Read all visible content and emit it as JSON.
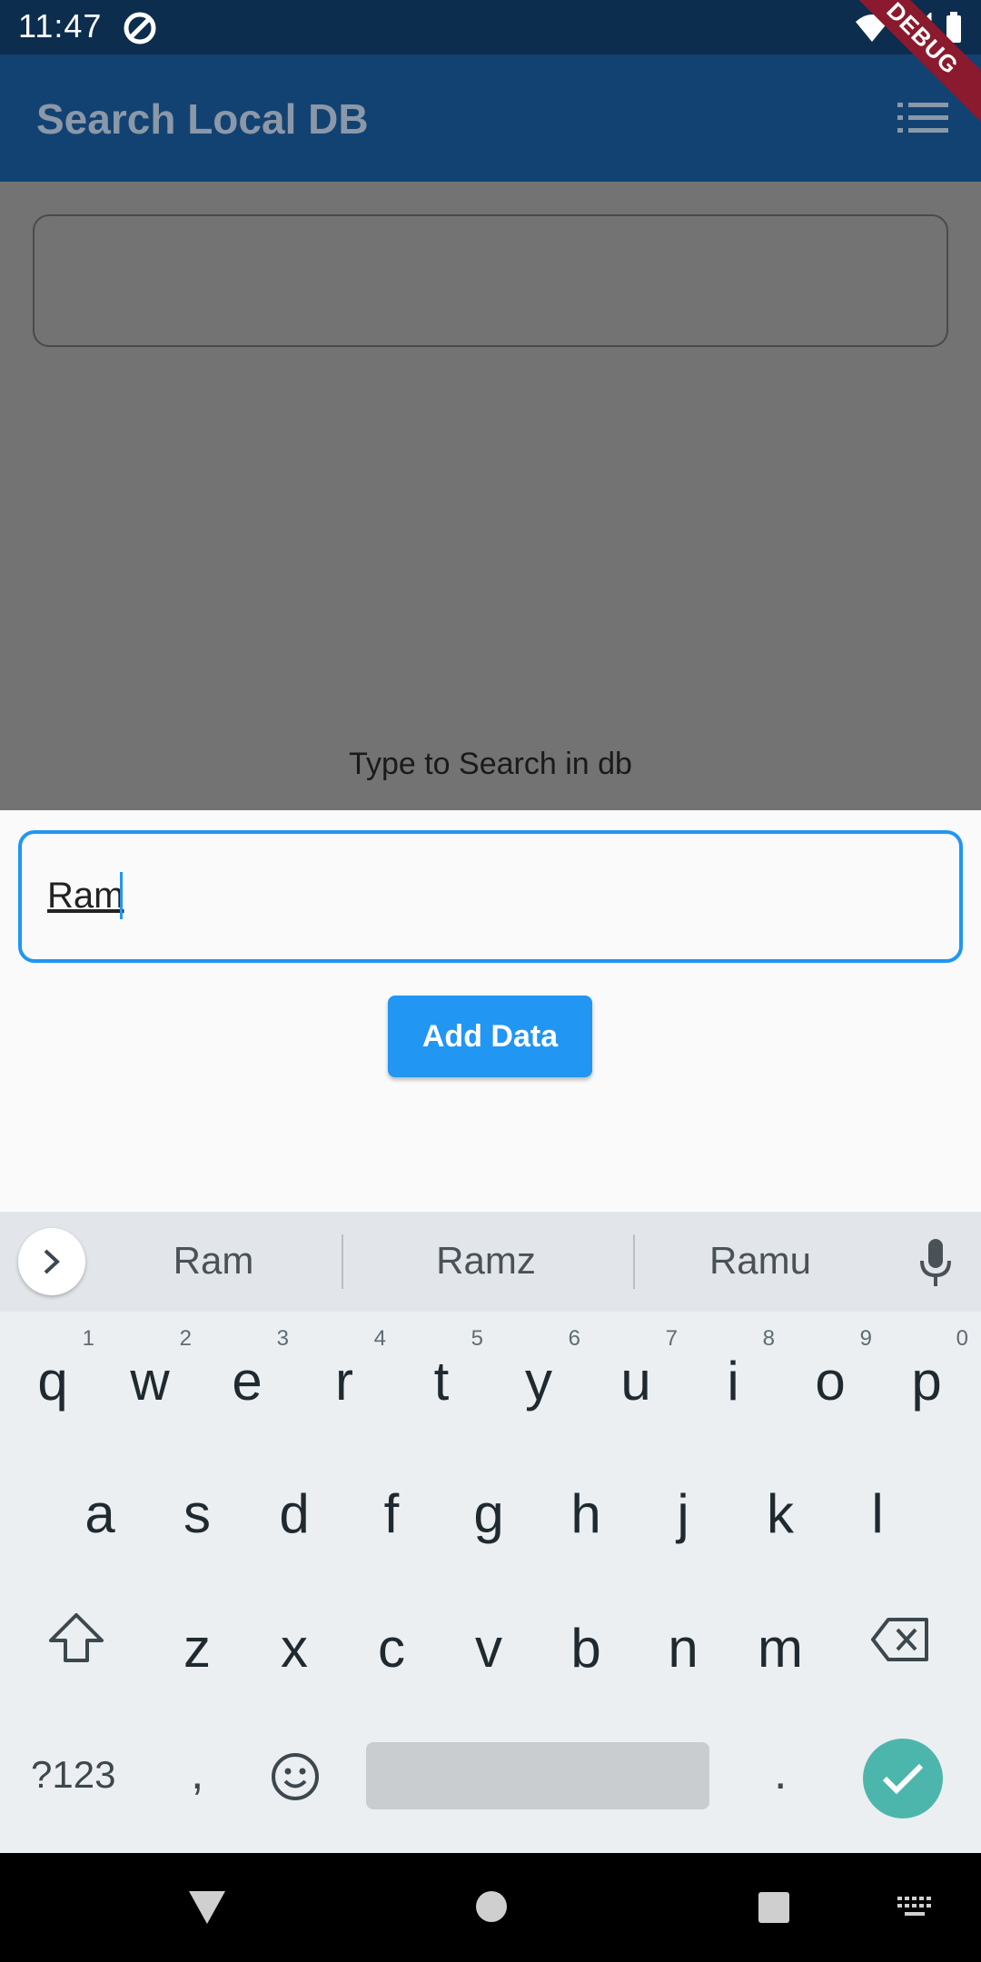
{
  "status_bar": {
    "time": "11:47",
    "debug_label": "DEBUG"
  },
  "app_bar": {
    "title": "Search Local DB",
    "menu_icon": "list-icon"
  },
  "background": {
    "hint": "Type to Search in db"
  },
  "sheet": {
    "input_value": "Ram",
    "add_button_label": "Add Data"
  },
  "keyboard": {
    "suggestions": [
      "Ram",
      "Ramz",
      "Ramu"
    ],
    "row1": [
      {
        "k": "q",
        "n": "1"
      },
      {
        "k": "w",
        "n": "2"
      },
      {
        "k": "e",
        "n": "3"
      },
      {
        "k": "r",
        "n": "4"
      },
      {
        "k": "t",
        "n": "5"
      },
      {
        "k": "y",
        "n": "6"
      },
      {
        "k": "u",
        "n": "7"
      },
      {
        "k": "i",
        "n": "8"
      },
      {
        "k": "o",
        "n": "9"
      },
      {
        "k": "p",
        "n": "0"
      }
    ],
    "row2": [
      "a",
      "s",
      "d",
      "f",
      "g",
      "h",
      "j",
      "k",
      "l"
    ],
    "row3": [
      "z",
      "x",
      "c",
      "v",
      "b",
      "n",
      "m"
    ],
    "symbols_label": "?123",
    "comma": ",",
    "period": "."
  },
  "colors": {
    "accent": "#2196f3",
    "app_bar": "#124272",
    "status_bar": "#0d2d4e",
    "enter_key": "#4db6ac",
    "debug_ribbon": "#8b1a2e"
  }
}
